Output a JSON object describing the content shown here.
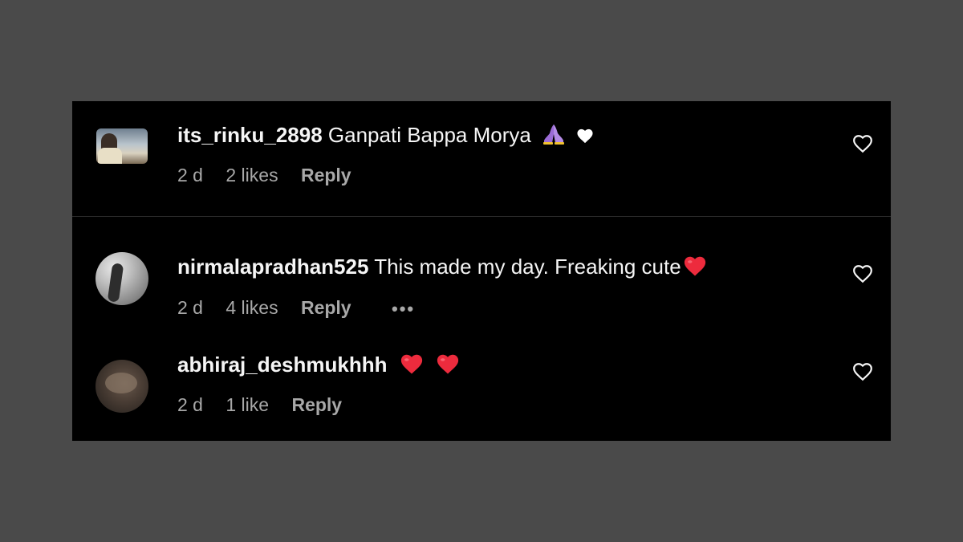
{
  "comments": [
    {
      "username": "its_rinku_2898",
      "text": "Ganpati Bappa Morya",
      "emojis": [
        "folded-hands-emoji",
        "white-heart-emoji"
      ],
      "time": "2 d",
      "likes": "2 likes",
      "reply": "Reply"
    },
    {
      "username": "nirmalapradhan525",
      "text": "This made my day. Freaking cute",
      "emojis": [
        "red-heart-emoji"
      ],
      "time": "2 d",
      "likes": "4 likes",
      "reply": "Reply",
      "more": "•••"
    },
    {
      "username": "abhiraj_deshmukhhh",
      "text": "",
      "emojis": [
        "red-heart-emoji",
        "red-heart-emoji"
      ],
      "time": "2 d",
      "likes": "1 like",
      "reply": "Reply"
    }
  ],
  "colors": {
    "background": "#4a4a4a",
    "panel": "#000000",
    "text": "#f5f5f5",
    "meta": "#a8a8a8",
    "heart": "#ed2b3d",
    "praying": "#9b6bd6"
  },
  "icons": {
    "like": "heart-outline-icon"
  }
}
